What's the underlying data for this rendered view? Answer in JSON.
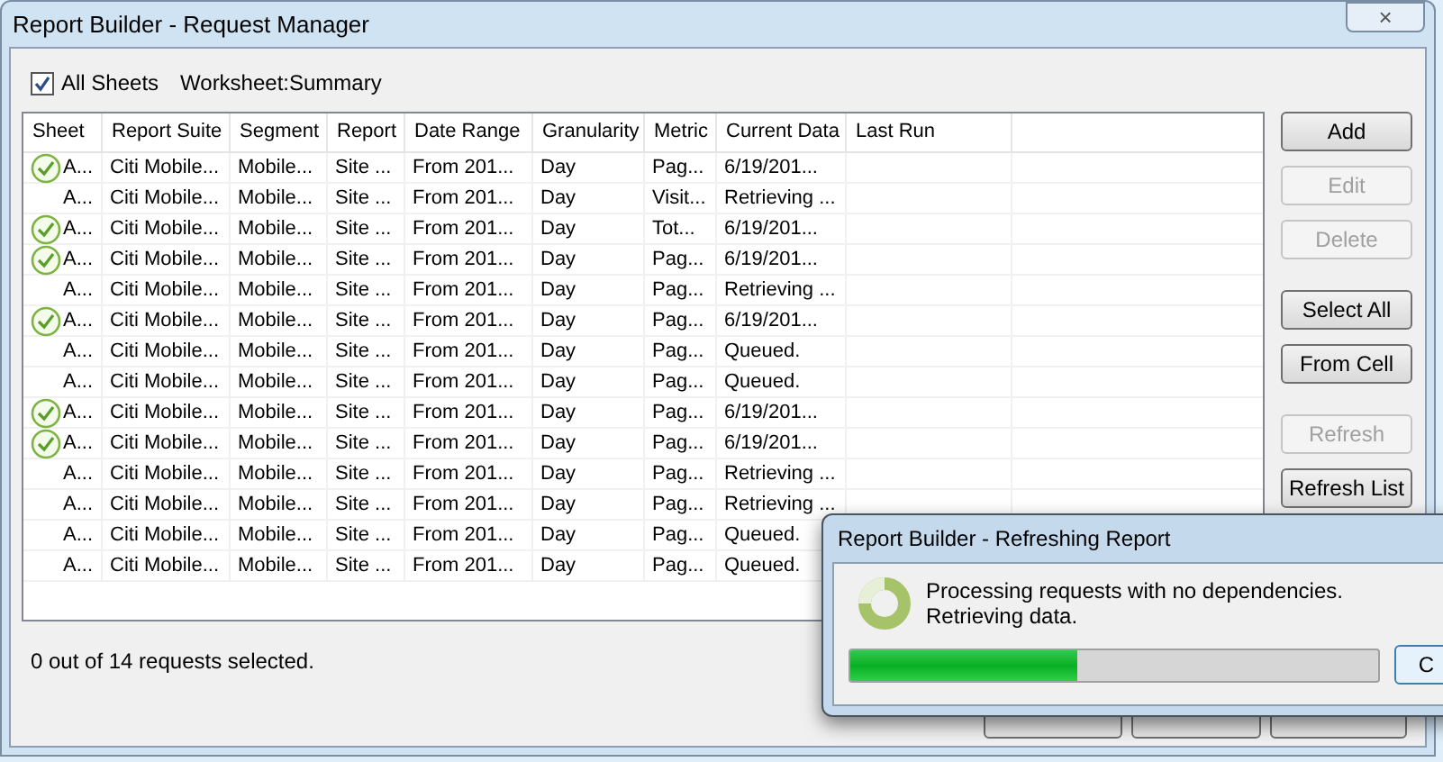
{
  "window": {
    "title": "Report Builder - Request Manager",
    "close": "×"
  },
  "all_sheets": {
    "label": "All Sheets",
    "checked": true
  },
  "worksheet": "Worksheet:Summary",
  "table": {
    "columns": [
      "Sheet",
      "Report Suite",
      "Segment",
      "Report",
      "Date Range",
      "Granularity",
      "Metric",
      "Current Data",
      "Last Run"
    ],
    "rows": [
      {
        "done": true,
        "cells": [
          "A...",
          "Citi Mobile...",
          "Mobile...",
          "Site ...",
          "From 201...",
          "Day",
          "Pag...",
          "6/19/201...",
          ""
        ]
      },
      {
        "done": false,
        "cells": [
          "A...",
          "Citi Mobile...",
          "Mobile...",
          "Site ...",
          "From 201...",
          "Day",
          "Visit...",
          "Retrieving ...",
          ""
        ]
      },
      {
        "done": true,
        "cells": [
          "A...",
          "Citi Mobile...",
          "Mobile...",
          "Site ...",
          "From 201...",
          "Day",
          "Tot...",
          "6/19/201...",
          ""
        ]
      },
      {
        "done": true,
        "cells": [
          "A...",
          "Citi Mobile...",
          "Mobile...",
          "Site ...",
          "From 201...",
          "Day",
          "Pag...",
          "6/19/201...",
          ""
        ]
      },
      {
        "done": false,
        "cells": [
          "A...",
          "Citi Mobile...",
          "Mobile...",
          "Site ...",
          "From 201...",
          "Day",
          "Pag...",
          "Retrieving ...",
          ""
        ]
      },
      {
        "done": true,
        "cells": [
          "A...",
          "Citi Mobile...",
          "Mobile...",
          "Site ...",
          "From 201...",
          "Day",
          "Pag...",
          "6/19/201...",
          ""
        ]
      },
      {
        "done": false,
        "cells": [
          "A...",
          "Citi Mobile...",
          "Mobile...",
          "Site ...",
          "From 201...",
          "Day",
          "Pag...",
          "Queued.",
          ""
        ]
      },
      {
        "done": false,
        "cells": [
          "A...",
          "Citi Mobile...",
          "Mobile...",
          "Site ...",
          "From 201...",
          "Day",
          "Pag...",
          "Queued.",
          ""
        ]
      },
      {
        "done": true,
        "cells": [
          "A...",
          "Citi Mobile...",
          "Mobile...",
          "Site ...",
          "From 201...",
          "Day",
          "Pag...",
          "6/19/201...",
          ""
        ]
      },
      {
        "done": true,
        "cells": [
          "A...",
          "Citi Mobile...",
          "Mobile...",
          "Site ...",
          "From 201...",
          "Day",
          "Pag...",
          "6/19/201...",
          ""
        ]
      },
      {
        "done": false,
        "cells": [
          "A...",
          "Citi Mobile...",
          "Mobile...",
          "Site ...",
          "From 201...",
          "Day",
          "Pag...",
          "Retrieving ...",
          ""
        ]
      },
      {
        "done": false,
        "cells": [
          "A...",
          "Citi Mobile...",
          "Mobile...",
          "Site ...",
          "From 201...",
          "Day",
          "Pag...",
          "Retrieving ...",
          ""
        ]
      },
      {
        "done": false,
        "cells": [
          "A...",
          "Citi Mobile...",
          "Mobile...",
          "Site ...",
          "From 201...",
          "Day",
          "Pag...",
          "Queued.",
          ""
        ]
      },
      {
        "done": false,
        "cells": [
          "A...",
          "Citi Mobile...",
          "Mobile...",
          "Site ...",
          "From 201...",
          "Day",
          "Pag...",
          "Queued.",
          ""
        ]
      }
    ]
  },
  "side_button_groups": [
    [
      {
        "label": "Add",
        "disabled": false
      },
      {
        "label": "Edit",
        "disabled": true
      },
      {
        "label": "Delete",
        "disabled": true
      }
    ],
    [
      {
        "label": "Select All",
        "disabled": false
      },
      {
        "label": "From Cell",
        "disabled": false
      }
    ],
    [
      {
        "label": "Refresh",
        "disabled": true
      },
      {
        "label": "Refresh List",
        "disabled": false
      }
    ]
  ],
  "status": "0 out of 14 requests selected.",
  "dialog": {
    "title": "Report Builder - Refreshing Report",
    "message": [
      "Processing requests with no dependencies.",
      "Retrieving data."
    ],
    "progress": {
      "level": 0.43
    },
    "button": "C"
  }
}
